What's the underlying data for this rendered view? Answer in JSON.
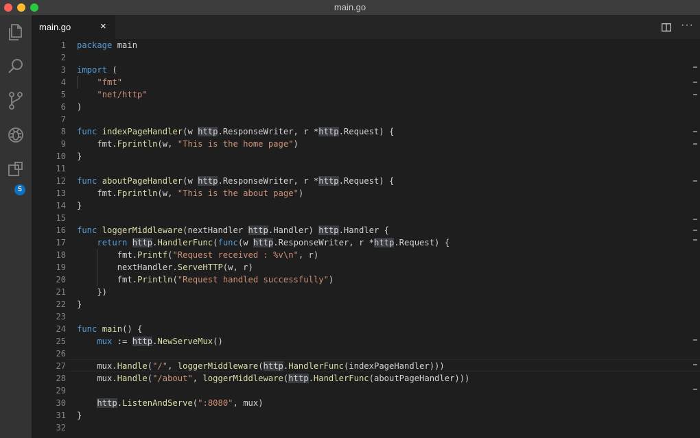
{
  "window": {
    "title": "main.go"
  },
  "activity_bar": {
    "items": [
      {
        "name": "explorer",
        "icon": "files-icon"
      },
      {
        "name": "search",
        "icon": "search-icon"
      },
      {
        "name": "source-control",
        "icon": "git-branch-icon"
      },
      {
        "name": "debug",
        "icon": "bug-icon"
      },
      {
        "name": "extensions",
        "icon": "extensions-icon"
      }
    ],
    "extensions_badge": "5"
  },
  "tabs": [
    {
      "label": "main.go",
      "close": "×",
      "active": true
    }
  ],
  "toolbar": {
    "more": "···"
  },
  "editor": {
    "language": "go",
    "current_line": 27,
    "line_numbers": [
      "1",
      "2",
      "3",
      "4",
      "5",
      "6",
      "7",
      "8",
      "9",
      "10",
      "11",
      "12",
      "13",
      "14",
      "15",
      "16",
      "17",
      "18",
      "19",
      "20",
      "21",
      "22",
      "23",
      "24",
      "25",
      "26",
      "27",
      "28",
      "29",
      "30",
      "31",
      "32"
    ],
    "lines": [
      "package main",
      "",
      "import (",
      "    \"fmt\"",
      "    \"net/http\"",
      ")",
      "",
      "func indexPageHandler(w http.ResponseWriter, r *http.Request) {",
      "    fmt.Fprintln(w, \"This is the home page\")",
      "}",
      "",
      "func aboutPageHandler(w http.ResponseWriter, r *http.Request) {",
      "    fmt.Fprintln(w, \"This is the about page\")",
      "}",
      "",
      "func loggerMiddleware(nextHandler http.Handler) http.Handler {",
      "    return http.HandlerFunc(func(w http.ResponseWriter, r *http.Request) {",
      "        fmt.Printf(\"Request received : %v\\n\", r)",
      "        nextHandler.ServeHTTP(w, r)",
      "        fmt.Println(\"Request handled successfully\")",
      "    })",
      "}",
      "",
      "func main() {",
      "    mux := http.NewServeMux()",
      "",
      "    mux.Handle(\"/\", loggerMiddleware(http.HandlerFunc(indexPageHandler)))",
      "    mux.Handle(\"/about\", loggerMiddleware(http.HandlerFunc(aboutPageHandler)))",
      "",
      "    http.ListenAndServe(\":8080\", mux)",
      "}",
      ""
    ]
  },
  "colors": {
    "keyword": "#569cd6",
    "function": "#dcdcaa",
    "string": "#ce9178",
    "text": "#d4d4d4",
    "highlight": "#3a3d41",
    "badge": "#0e70c0"
  }
}
